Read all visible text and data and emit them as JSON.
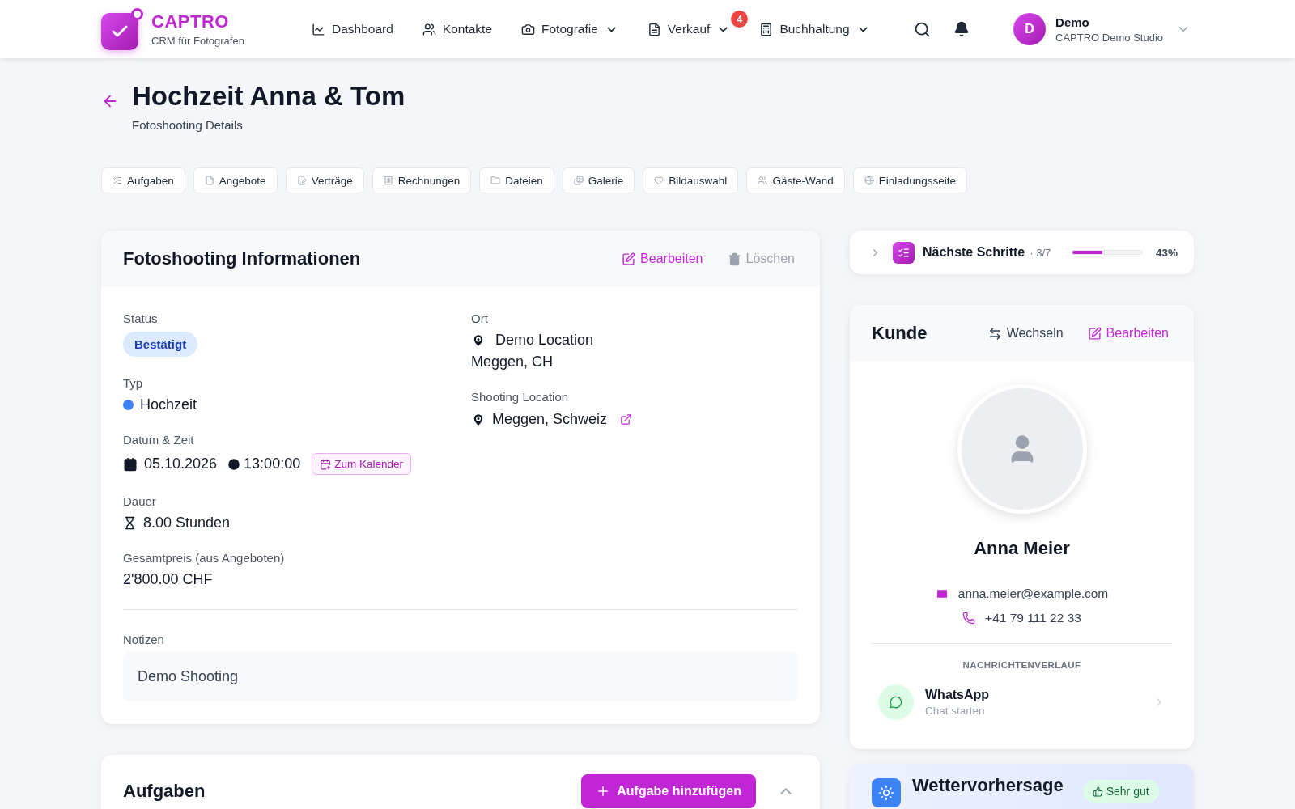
{
  "header": {
    "logo": {
      "name": "CAPTRO",
      "tagline": "CRM für Fotografen"
    },
    "nav": [
      {
        "label": "Dashboard",
        "dropdown": false
      },
      {
        "label": "Kontakte",
        "dropdown": false
      },
      {
        "label": "Fotografie",
        "dropdown": true
      },
      {
        "label": "Verkauf",
        "dropdown": true,
        "badge": "4"
      },
      {
        "label": "Buchhaltung",
        "dropdown": true
      }
    ],
    "user": {
      "initial": "D",
      "name": "Demo",
      "studio": "CAPTRO Demo Studio"
    }
  },
  "page": {
    "title": "Hochzeit Anna & Tom",
    "subtitle": "Fotoshooting Details"
  },
  "tabs": [
    {
      "label": "Aufgaben"
    },
    {
      "label": "Angebote"
    },
    {
      "label": "Verträge"
    },
    {
      "label": "Rechnungen"
    },
    {
      "label": "Dateien"
    },
    {
      "label": "Galerie"
    },
    {
      "label": "Bildauswahl"
    },
    {
      "label": "Gäste-Wand"
    },
    {
      "label": "Einladungsseite"
    }
  ],
  "info_card": {
    "title": "Fotoshooting Informationen",
    "edit": "Bearbeiten",
    "delete": "Löschen",
    "status": {
      "label": "Status",
      "value": "Bestätigt"
    },
    "type": {
      "label": "Typ",
      "value": "Hochzeit",
      "color": "#3b82f6"
    },
    "datetime": {
      "label": "Datum & Zeit",
      "date": "05.10.2026",
      "time": "13:00:00",
      "calendar_button": "Zum Kalender"
    },
    "duration": {
      "label": "Dauer",
      "value": "8.00 Stunden"
    },
    "price": {
      "label": "Gesamtpreis (aus Angeboten)",
      "value": "2'800.00 CHF"
    },
    "location": {
      "label": "Ort",
      "name": "Demo Location",
      "city": "Meggen, CH"
    },
    "shooting_location": {
      "label": "Shooting Location",
      "value": "Meggen, Schweiz"
    },
    "notes": {
      "label": "Notizen",
      "value": "Demo Shooting"
    }
  },
  "tasks_card": {
    "title": "Aufgaben",
    "add_button": "Aufgabe hinzufügen"
  },
  "next_steps": {
    "title": "Nächste Schritte",
    "count": "· 3/7",
    "level": 0.43,
    "percent": "43%"
  },
  "customer": {
    "title": "Kunde",
    "switch": "Wechseln",
    "edit": "Bearbeiten",
    "name": "Anna Meier",
    "email": "anna.meier@example.com",
    "phone": "+41 79 111 22 33",
    "history_heading": "NACHRICHTENVERLAUF",
    "channel": {
      "name": "WhatsApp",
      "action": "Chat starten"
    }
  },
  "weather": {
    "title": "Wettervorhersage",
    "rating": "Sehr gut"
  }
}
